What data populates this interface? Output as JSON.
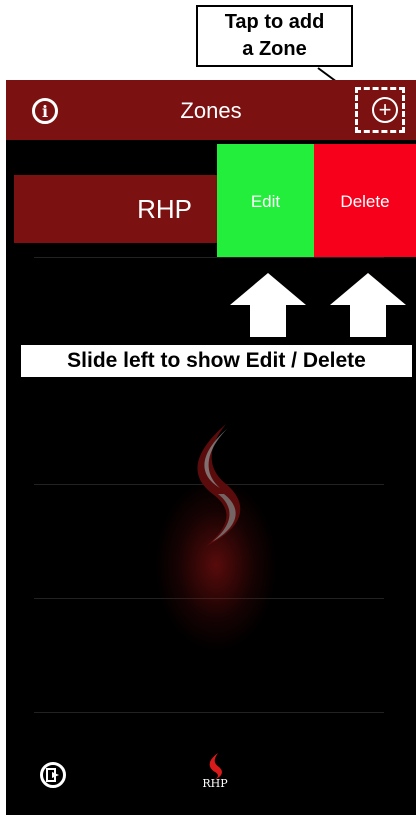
{
  "tooltip": {
    "line1": "Tap to add",
    "line2": "a Zone"
  },
  "header": {
    "title": "Zones",
    "info_icon": "info-icon",
    "add_icon": "add-circle-icon"
  },
  "zones": [
    {
      "name": "RHP"
    }
  ],
  "swipe_actions": {
    "edit_label": "Edit",
    "delete_label": "Delete",
    "edit_color": "#22ee3b",
    "delete_color": "#f6001c"
  },
  "hint": {
    "text": "Slide left to show Edit / Delete"
  },
  "footer": {
    "logout_icon": "logout-icon",
    "logo_text": "RHP"
  },
  "colors": {
    "header": "#7b1211",
    "background": "#000000"
  }
}
